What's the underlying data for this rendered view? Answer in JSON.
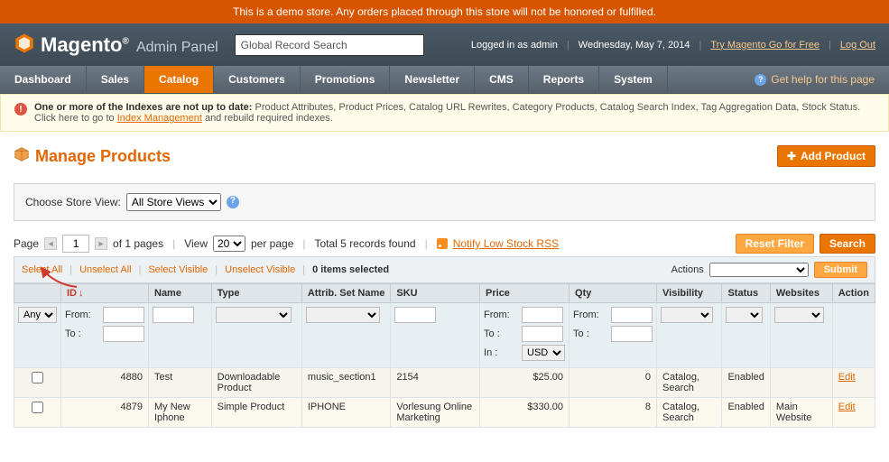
{
  "demo_notice": "This is a demo store. Any orders placed through this store will not be honored or fulfilled.",
  "brand": {
    "name": "Magento",
    "sub": "Admin Panel"
  },
  "search": {
    "placeholder": "Global Record Search"
  },
  "session": {
    "logged_in": "Logged in as admin",
    "date": "Wednesday, May 7, 2014",
    "try_link": "Try Magento Go for Free",
    "logout": "Log Out"
  },
  "nav": {
    "dashboard": "Dashboard",
    "sales": "Sales",
    "catalog": "Catalog",
    "customers": "Customers",
    "promotions": "Promotions",
    "newsletter": "Newsletter",
    "cms": "CMS",
    "reports": "Reports",
    "system": "System",
    "help": "Get help for this page"
  },
  "index_notice": {
    "bold": "One or more of the Indexes are not up to date:",
    "rest": " Product Attributes, Product Prices, Catalog URL Rewrites, Category Products, Catalog Search Index, Tag Aggregation Data, Stock Status. Click here to go to ",
    "link": "Index Management",
    "rest2": " and rebuild required indexes."
  },
  "page_title": "Manage Products",
  "add_button": "Add Product",
  "store_view": {
    "label": "Choose Store View:",
    "selected": "All Store Views"
  },
  "pager": {
    "page_label": "Page",
    "page_value": "1",
    "of_pages": "of 1 pages",
    "view_label": "View",
    "per_page_value": "20",
    "per_page_suffix": "per page",
    "total": "Total 5 records found",
    "rss": "Notify Low Stock RSS",
    "reset": "Reset Filter",
    "search": "Search"
  },
  "mass": {
    "select_all": "Select All",
    "unselect_all": "Unselect All",
    "select_visible": "Select Visible",
    "unselect_visible": "Unselect Visible",
    "items_selected": "0 items selected",
    "actions_label": "Actions",
    "submit": "Submit"
  },
  "columns": {
    "checkbox": "",
    "id": "ID",
    "name": "Name",
    "type": "Type",
    "attrib": "Attrib. Set Name",
    "sku": "SKU",
    "price": "Price",
    "qty": "Qty",
    "visibility": "Visibility",
    "status": "Status",
    "websites": "Websites",
    "action": "Action"
  },
  "filter": {
    "any": "Any",
    "from": "From:",
    "to": "To :",
    "in": "In :",
    "currency": "USD"
  },
  "rows": [
    {
      "id": "4880",
      "name": "Test",
      "type": "Downloadable Product",
      "attrib": "music_section1",
      "sku": "2154",
      "price": "$25.00",
      "qty": "0",
      "visibility": "Catalog, Search",
      "status": "Enabled",
      "websites": "",
      "action": "Edit"
    },
    {
      "id": "4879",
      "name": "My New Iphone",
      "type": "Simple Product",
      "attrib": "IPHONE",
      "sku": "Vorlesung Online Marketing",
      "price": "$330.00",
      "qty": "8",
      "visibility": "Catalog, Search",
      "status": "Enabled",
      "websites": "Main Website",
      "action": "Edit"
    }
  ]
}
